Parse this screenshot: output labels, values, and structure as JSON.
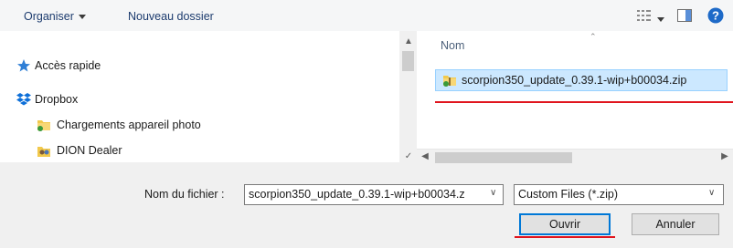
{
  "toolbar": {
    "organise_label": "Organiser",
    "new_folder_label": "Nouveau dossier",
    "help_icon": "help-icon",
    "help_color": "#1e6ac8"
  },
  "navigation": {
    "items": [
      {
        "label": "Accès rapide",
        "icon": "star-icon"
      },
      {
        "label": "Dropbox",
        "icon": "dropbox-icon"
      },
      {
        "label": "Chargements appareil photo",
        "icon": "folder-icon"
      },
      {
        "label": "DION Dealer",
        "icon": "user-folder-icon"
      }
    ]
  },
  "files": {
    "column_name": "Nom",
    "items": [
      {
        "name": "scorpion350_update_0.39.1-wip+b00034.zip",
        "icon": "zip-folder-icon",
        "selected": true
      }
    ]
  },
  "filename": {
    "label": "Nom du fichier :",
    "value": "scorpion350_update_0.39.1-wip+b00034.z"
  },
  "filter": {
    "selected": "Custom Files (*.zip)"
  },
  "buttons": {
    "open": "Ouvrir",
    "cancel": "Annuler"
  },
  "colors": {
    "selection": "#cce8ff",
    "accent_underline": "#e0151e",
    "primary_border": "#0078d7"
  }
}
